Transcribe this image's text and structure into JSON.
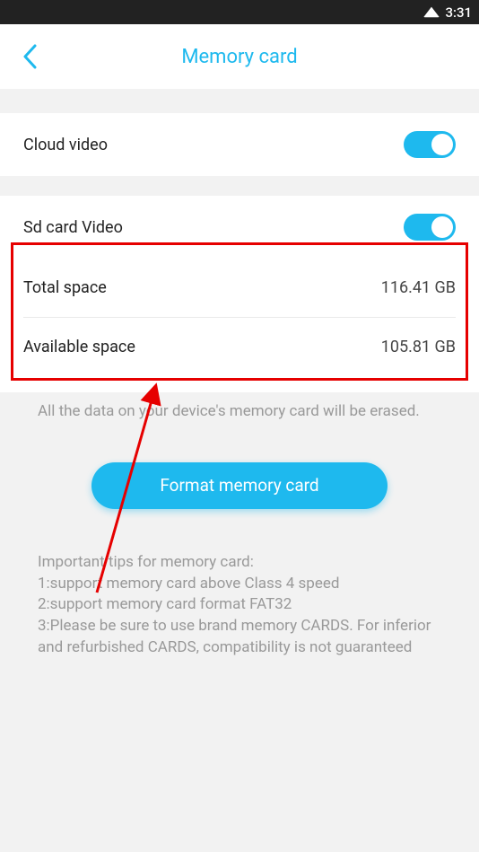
{
  "status": {
    "time": "3:31"
  },
  "header": {
    "title": "Memory card"
  },
  "cloud": {
    "label": "Cloud video",
    "on": true
  },
  "sdcard": {
    "label": "Sd card Video",
    "on": true
  },
  "space": {
    "total_label": "Total space",
    "total_value": "116.41 GB",
    "avail_label": "Available space",
    "avail_value": "105.81 GB"
  },
  "erase_note": "All the data on your device's memory card will be erased.",
  "format_btn": "Format memory card",
  "tips_title": "Important tips for memory card:",
  "tips_1": " 1:support memory card above Class 4 speed",
  "tips_2": " 2:support memory card format FAT32",
  "tips_3": " 3:Please be sure to use brand memory CARDS. For inferior and refurbished CARDS, compatibility is not guaranteed"
}
